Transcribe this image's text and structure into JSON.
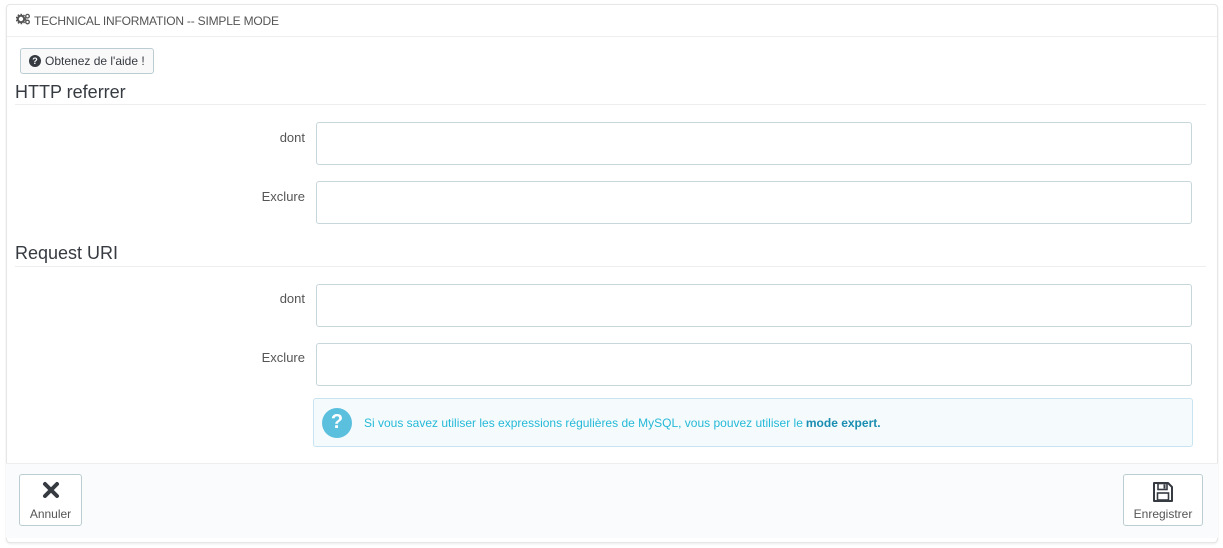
{
  "header": {
    "title": "TECHNICAL INFORMATION -- SIMPLE MODE",
    "icon": "cogs-icon"
  },
  "help_button": {
    "label": "Obtenez de l'aide !",
    "icon": "question-circle-icon"
  },
  "sections": [
    {
      "title": "HTTP referrer",
      "fields": [
        {
          "label": "dont",
          "value": ""
        },
        {
          "label": "Exclure",
          "value": ""
        }
      ]
    },
    {
      "title": "Request URI",
      "fields": [
        {
          "label": "dont",
          "value": ""
        },
        {
          "label": "Exclure",
          "value": ""
        }
      ]
    }
  ],
  "info_alert": {
    "icon": "question-circle-icon",
    "text": "Si vous savez utiliser les expressions régulières de MySQL, vous pouvez utiliser le",
    "link_text": "mode expert."
  },
  "footer": {
    "cancel_label": "Annuler",
    "cancel_icon": "close-icon",
    "save_label": "Enregistrer",
    "save_icon": "save-icon"
  },
  "colors": {
    "accent": "#25b9d7",
    "alert_icon": "#5bc0de",
    "border": "#bbcdd2"
  }
}
